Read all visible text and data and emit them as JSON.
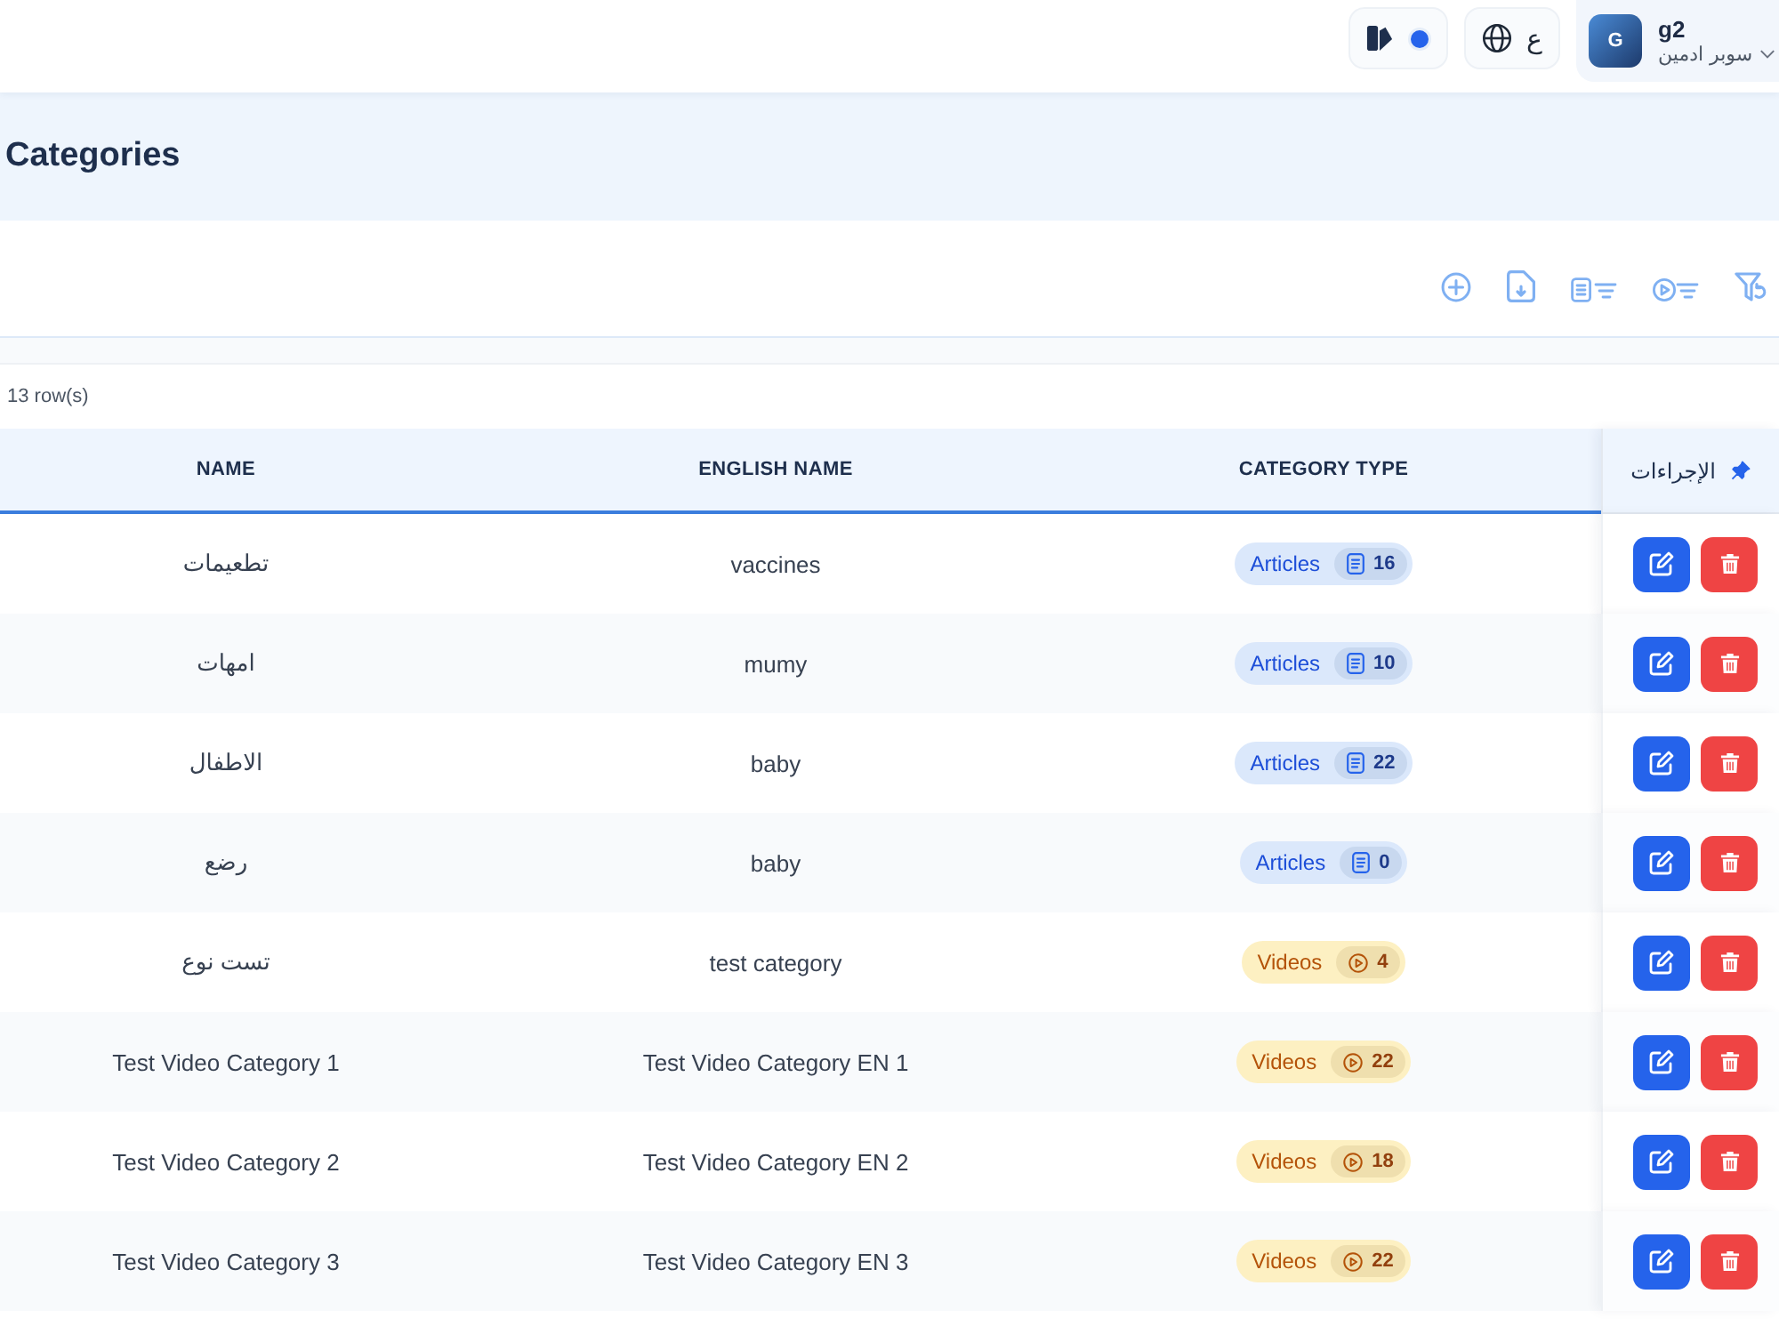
{
  "top_bar": {
    "language_button": {
      "label": "ع"
    },
    "user": {
      "avatar_initial": "G",
      "name": "g2",
      "role": "سوبر ادمين"
    }
  },
  "page": {
    "title": "Categories"
  },
  "table": {
    "row_count": "13 row(s)",
    "columns": [
      {
        "label": "NAME",
        "pinned": false
      },
      {
        "label": "ENGLISH NAME",
        "pinned": false
      },
      {
        "label": "CATEGORY TYPE",
        "pinned": false
      },
      {
        "label": "الإجراءات",
        "pinned": true
      }
    ],
    "rows": [
      {
        "name": "تطعيمات",
        "english_name": "vaccines",
        "category_type": {
          "kind": "articles",
          "label": "Articles",
          "count": "16"
        }
      },
      {
        "name": "امهات",
        "english_name": "mumy",
        "category_type": {
          "kind": "articles",
          "label": "Articles",
          "count": "10"
        }
      },
      {
        "name": "الاطفال",
        "english_name": "baby",
        "category_type": {
          "kind": "articles",
          "label": "Articles",
          "count": "22"
        }
      },
      {
        "name": "رضع",
        "english_name": "baby",
        "category_type": {
          "kind": "articles",
          "label": "Articles",
          "count": "0"
        }
      },
      {
        "name": "تست نوع",
        "english_name": "test category",
        "category_type": {
          "kind": "videos",
          "label": "Videos",
          "count": "4"
        }
      },
      {
        "name": "Test Video Category 1",
        "english_name": "Test Video Category EN 1",
        "category_type": {
          "kind": "videos",
          "label": "Videos",
          "count": "22"
        }
      },
      {
        "name": "Test Video Category 2",
        "english_name": "Test Video Category EN 2",
        "category_type": {
          "kind": "videos",
          "label": "Videos",
          "count": "18"
        }
      },
      {
        "name": "Test Video Category 3",
        "english_name": "Test Video Category EN 3",
        "category_type": {
          "kind": "videos",
          "label": "Videos",
          "count": "22"
        }
      }
    ]
  }
}
